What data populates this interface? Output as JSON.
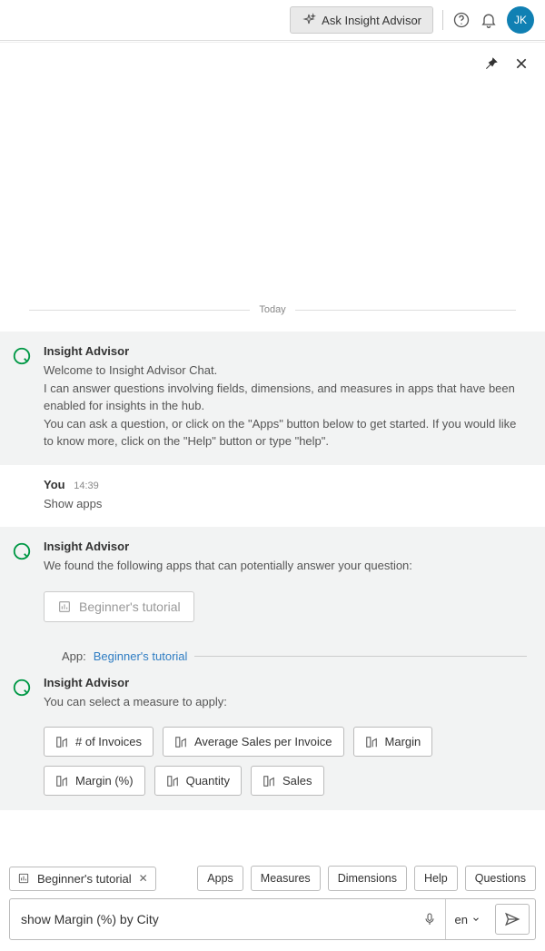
{
  "topbar": {
    "ask_label": "Ask Insight Advisor",
    "avatar_initials": "JK"
  },
  "chat": {
    "date_divider": "Today",
    "messages": [
      {
        "sender": "Insight Advisor",
        "lines": [
          "Welcome to Insight Advisor Chat.",
          "I can answer questions involving fields, dimensions, and measures in apps that have been enabled for insights in the hub.",
          "You can ask a question, or click on the \"Apps\" button below to get started. If you would like to know more, click on the \"Help\" button or type \"help\"."
        ]
      },
      {
        "sender": "You",
        "time": "14:39",
        "lines": [
          "Show apps"
        ]
      },
      {
        "sender": "Insight Advisor",
        "lines": [
          "We found the following apps that can potentially answer your question:"
        ],
        "app_chip": "Beginner's tutorial"
      }
    ],
    "context": {
      "label": "App:",
      "app_link": "Beginner's tutorial"
    },
    "measure_prompt": {
      "sender": "Insight Advisor",
      "text": "You can select a measure to apply:",
      "measures": [
        "# of Invoices",
        "Average Sales per Invoice",
        "Margin",
        "Margin (%)",
        "Quantity",
        "Sales"
      ]
    }
  },
  "footer": {
    "context_pill": "Beginner's tutorial",
    "quick_buttons": [
      "Apps",
      "Measures",
      "Dimensions",
      "Help",
      "Questions"
    ],
    "input_value": "show Margin (%) by City",
    "language": "en"
  }
}
